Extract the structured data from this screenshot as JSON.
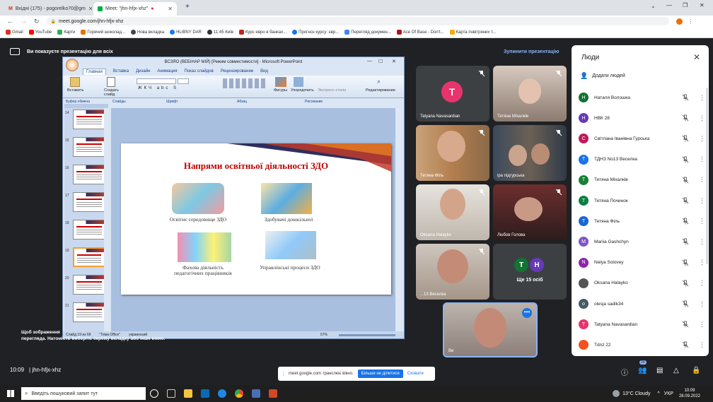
{
  "browser": {
    "tabs": [
      {
        "title": "Вхідні (175) - pogorelko70@gm"
      },
      {
        "title": "Meet: \"jhn-hfjx-xhz\""
      }
    ],
    "url": "meet.google.com/jhn-hfjx-xhz",
    "bookmarks": [
      "Gmail",
      "YouTube",
      "Карти",
      "Горячий шоколад...",
      "Нова вкладка",
      "HLIBNY DAR",
      "11:45 Київ",
      "Курс евро в банках...",
      "Прогноз курсу: євр...",
      "Перегляд докумен...",
      "Ace Of Base - Don't...",
      "Карта повітряних т..."
    ]
  },
  "meet": {
    "banner": "Ви показуєте презентацію для всіх",
    "stop": "Зупинити презентацію",
    "warning_line1": "Щоб зображення",
    "warning_line2": "перегляда. Натомість виберіть окрему вкладку або інше вікно.",
    "meeting_time": "10:09",
    "meeting_code": "jhn-hfjx-xhz",
    "share_notice": "meet.google.com транслює вікно.",
    "share_stop": "Більше не ділитися",
    "share_hide": "Сховати",
    "people_badge": "24"
  },
  "ppt": {
    "title": "ВСЗЯО (ВЕБІНАР МІЙ) [Режим совместимости] - Microsoft PowerPoint",
    "tabs": [
      "Главная",
      "Вставка",
      "Дизайн",
      "Анимация",
      "Показ слайдов",
      "Рецензирование",
      "Вид"
    ],
    "groups": [
      "Буфер обмена",
      "Слайды",
      "Шрифт",
      "Абзац",
      "Рисование",
      "Редактирование"
    ],
    "buttons": {
      "paste": "Вставить",
      "create": "Создать слайд",
      "shapes": "Фигуры",
      "arrange": "Упорядочить",
      "styles": "Экспресс-стили",
      "edit": "Редактирование"
    },
    "slide_numbers": [
      "14",
      "15",
      "16",
      "17",
      "18",
      "19",
      "20",
      "21"
    ],
    "status": {
      "slide": "Слайд 19 из 69",
      "theme": "\"Тема Office\"",
      "lang": "украинский",
      "zoom": "57%"
    },
    "slide": {
      "title": "Напрями освітньої діяльності ЗДО",
      "items": [
        "Освітнє середовище ЗДО",
        "Здобувачі дошкільної",
        "Фахова діяльність педагогічних працівників",
        "Управлінські процеси ЗДО"
      ]
    }
  },
  "tiles": [
    {
      "name": "Tatyana Navasardian",
      "initial": "T",
      "color": "#e8336d"
    },
    {
      "name": "Тетяна Міхалків"
    },
    {
      "name": "Тетяна Філь"
    },
    {
      "name": "іра підгурська"
    },
    {
      "name": "Oksana Halayko"
    },
    {
      "name": "Любов Голова"
    },
    {
      "name": "...13 Веселка"
    },
    {
      "name": "Ще 15 осіб",
      "initials": [
        "T",
        "H"
      ]
    },
    {
      "name": "Ви"
    }
  ],
  "people": {
    "title": "Люди",
    "add": "Додати людей",
    "list": [
      {
        "name": "Наталя Волошка",
        "initial": "Н",
        "color": "#137333"
      },
      {
        "name": "НВК 28",
        "initial": "Н",
        "color": "#673ab7"
      },
      {
        "name": "Світлана Іванівна Гурська",
        "initial": "С",
        "color": "#c2185b"
      },
      {
        "name": "ТДНЗ No13 Веселка",
        "initial": "Т",
        "color": "#1a73e8"
      },
      {
        "name": "Тетяна Міхалків",
        "initial": "Т",
        "color": "#188038"
      },
      {
        "name": "Тетяна Починок",
        "initial": "Т",
        "color": "#0b8043"
      },
      {
        "name": "Тетяна Філь",
        "initial": "Т",
        "color": "#1967d2"
      },
      {
        "name": "Mariia Gashchyn",
        "initial": "M",
        "color": "#7e57c2"
      },
      {
        "name": "Nelya Solovey",
        "initial": "N",
        "color": "#8e24aa"
      },
      {
        "name": "Oksana Halayko",
        "initial": "",
        "color": "#555"
      },
      {
        "name": "olesja sadik34",
        "initial": "o",
        "color": "#455a64"
      },
      {
        "name": "Tatyana Navasardian",
        "initial": "T",
        "color": "#e8336d"
      },
      {
        "name": "Tdnz 22",
        "initial": "",
        "color": "#f4511e"
      }
    ]
  },
  "taskbar": {
    "search": "Введіть пошуковий запит тут",
    "weather": "13°C Cloudy",
    "lang": "УКР",
    "time": "10:09",
    "date": "28.09.2022"
  }
}
